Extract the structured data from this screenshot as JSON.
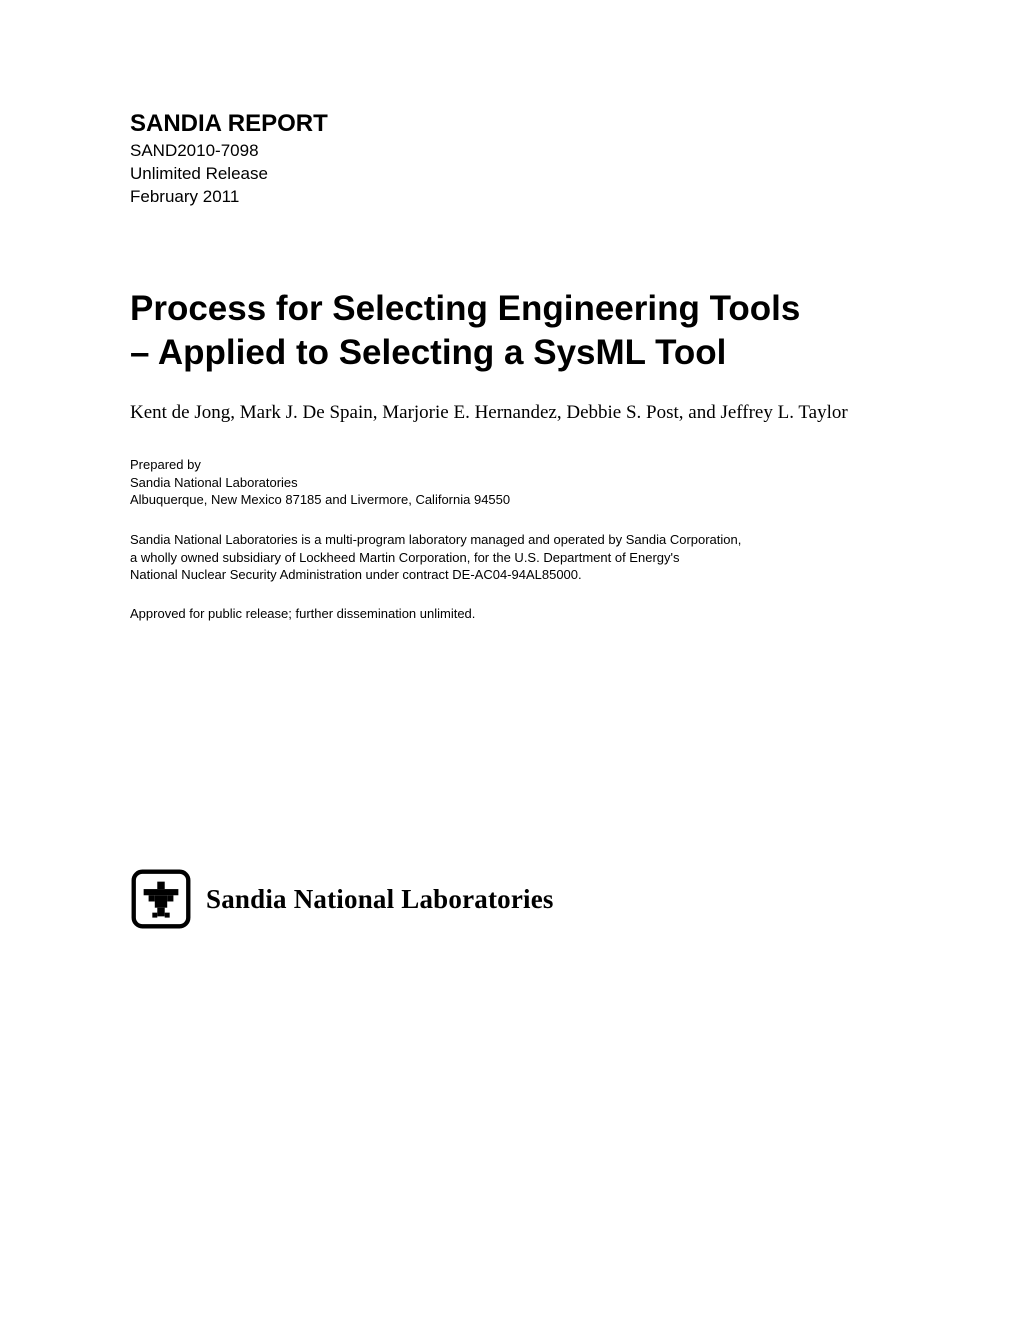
{
  "header": {
    "report_label": "SANDIA REPORT",
    "report_number": "SAND2010-7098",
    "release": "Unlimited Release",
    "date": "February 2011"
  },
  "title": {
    "line1": "Process for Selecting Engineering Tools",
    "line2": "– Applied to Selecting a SysML Tool"
  },
  "authors": "Kent de Jong, Mark J. De Spain, Marjorie E. Hernandez, Debbie S. Post, and Jeffrey L. Taylor",
  "prepared": {
    "line1": "Prepared by",
    "line2": "Sandia National Laboratories",
    "line3": "Albuquerque, New Mexico  87185 and Livermore, California  94550"
  },
  "corp": {
    "line1": "Sandia National Laboratories is a multi-program laboratory managed and operated by Sandia Corporation,",
    "line2": "a wholly owned subsidiary of Lockheed Martin Corporation, for the U.S. Department of Energy's",
    "line3": "National Nuclear Security Administration under contract DE-AC04-94AL85000."
  },
  "approval": "Approved for public release; further dissemination unlimited.",
  "logo": {
    "text": "Sandia National Laboratories"
  }
}
